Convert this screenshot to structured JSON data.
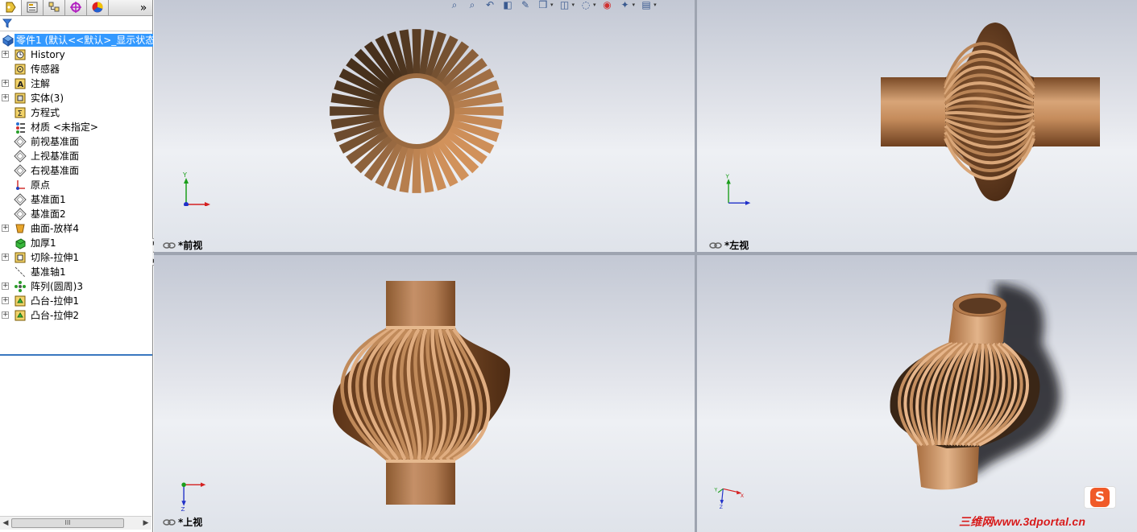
{
  "feature_manager": {
    "tabs": [
      "featuremanager-tab",
      "propertymanager-tab",
      "configurationmanager-tab",
      "dimxpert-tab",
      "display-manager-tab"
    ],
    "more": "»",
    "root": "零件1  (默认<<默认>_显示状态",
    "items": [
      {
        "label": "History",
        "icon": "history-icon",
        "expandable": true
      },
      {
        "label": "传感器",
        "icon": "sensor-icon",
        "expandable": false
      },
      {
        "label": "注解",
        "icon": "annotation-icon",
        "expandable": true
      },
      {
        "label": "实体(3)",
        "icon": "solid-bodies-icon",
        "expandable": true
      },
      {
        "label": "方程式",
        "icon": "equation-icon",
        "expandable": false
      },
      {
        "label": "材质 <未指定>",
        "icon": "material-icon",
        "expandable": false
      },
      {
        "label": "前视基准面",
        "icon": "plane-icon",
        "expandable": false
      },
      {
        "label": "上视基准面",
        "icon": "plane-icon",
        "expandable": false
      },
      {
        "label": "右视基准面",
        "icon": "plane-icon",
        "expandable": false
      },
      {
        "label": "原点",
        "icon": "origin-icon",
        "expandable": false
      },
      {
        "label": "基准面1",
        "icon": "plane-icon",
        "expandable": false
      },
      {
        "label": "基准面2",
        "icon": "plane-icon",
        "expandable": false
      },
      {
        "label": "曲面-放样4",
        "icon": "surface-loft-icon",
        "expandable": true
      },
      {
        "label": "加厚1",
        "icon": "thicken-icon",
        "expandable": false
      },
      {
        "label": "切除-拉伸1",
        "icon": "cut-extrude-icon",
        "expandable": true
      },
      {
        "label": "基准轴1",
        "icon": "axis-icon",
        "expandable": false
      },
      {
        "label": "阵列(圆周)3",
        "icon": "circular-pattern-icon",
        "expandable": true
      },
      {
        "label": "凸台-拉伸1",
        "icon": "boss-extrude-icon",
        "expandable": true
      },
      {
        "label": "凸台-拉伸2",
        "icon": "boss-extrude-icon",
        "expandable": true
      }
    ],
    "scroll_thumb": "III"
  },
  "viewports": {
    "front": {
      "label": "*前视"
    },
    "left": {
      "label": "*左视"
    },
    "top": {
      "label": "*上视"
    },
    "iso": {
      "label": ""
    }
  },
  "triad_axes": {
    "x": "X",
    "y": "Y",
    "z": "Z"
  },
  "hud_icons": [
    "zoom-to-fit-icon",
    "zoom-area-icon",
    "previous-view-icon",
    "section-view-icon",
    "dynamic-annotation-icon",
    "view-orientation-icon",
    "display-style-icon",
    "hide-show-items-icon",
    "edit-appearance-icon",
    "apply-scene-icon",
    "view-settings-icon"
  ],
  "colors": {
    "wood": "#b07a4a",
    "selection": "#3399ff",
    "axis_x": "#d42020",
    "axis_y": "#1a9e1a",
    "axis_z": "#2030c8"
  },
  "watermark": {
    "logo": "S",
    "text": "三维网www.3dportal.cn"
  }
}
